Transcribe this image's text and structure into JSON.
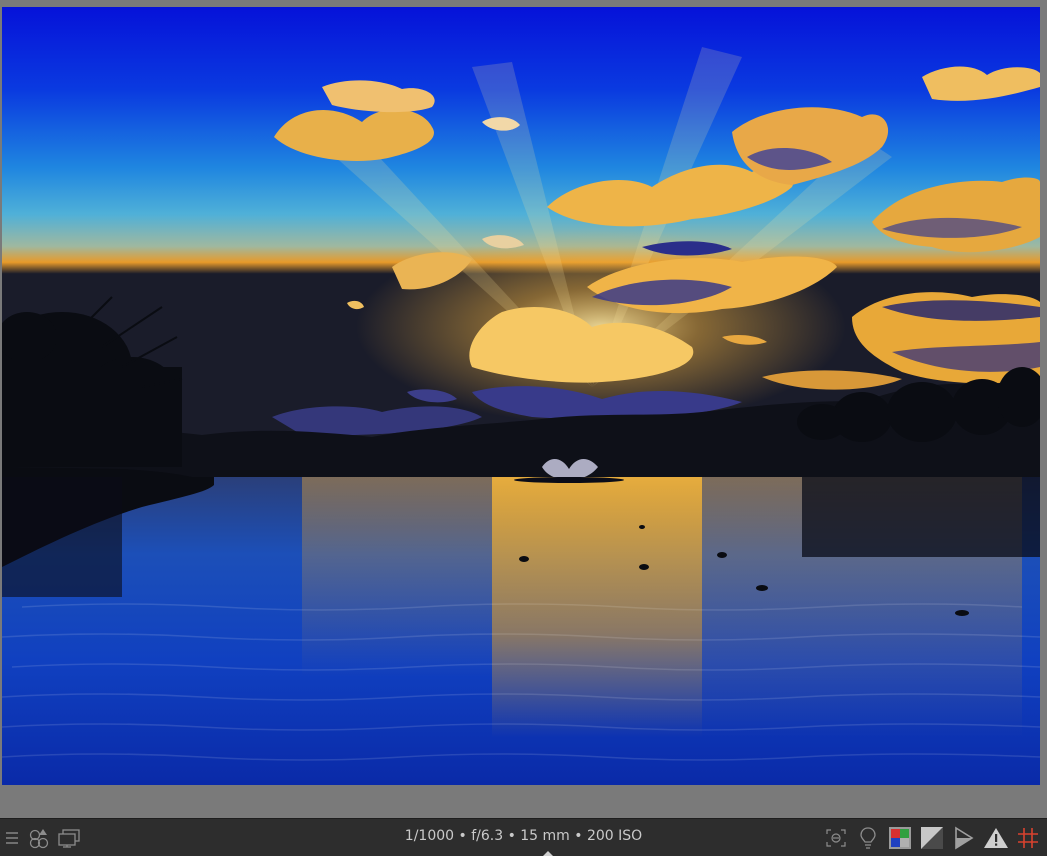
{
  "viewer": {
    "photo_alt": "Sunset over a lake with a fountain"
  },
  "bottom_bar": {
    "exif_text": "1/1000 • f/6.3 • 15 mm • 200 ISO",
    "left_icons": [
      "menu-icon",
      "styles-icon",
      "display-icon"
    ],
    "right_icons": [
      "focus-peaking-icon",
      "bulb-icon",
      "color-assessment-icon",
      "clipping-icon",
      "softproof-icon",
      "gamut-warning-icon",
      "guides-icon"
    ]
  },
  "colors": {
    "bottom_bar_bg": "#2d2d2d",
    "workspace_bg": "#7a7a7a",
    "text": "#c9c9c9",
    "guides_accent": "#d8422f",
    "warning_accent": "#d0d0d0"
  }
}
